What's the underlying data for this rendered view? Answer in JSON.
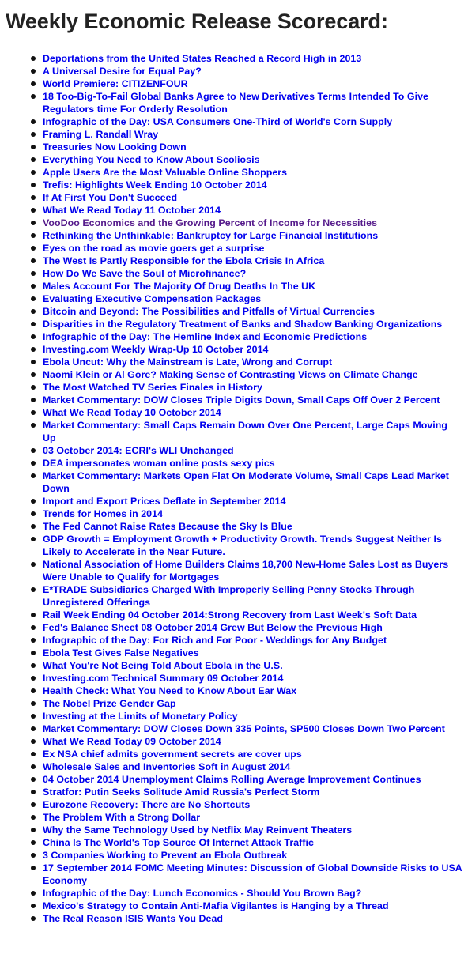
{
  "title": "Weekly Economic Release Scorecard:",
  "colors": {
    "title": "#222222",
    "link": "#0000ee",
    "visited_link": "#551a8b"
  },
  "items": [
    {
      "label": "Deportations from the United States Reached a Record High in 2013",
      "visited": false
    },
    {
      "label": "A Universal Desire for Equal Pay?",
      "visited": false
    },
    {
      "label": "World Premiere: CITIZENFOUR",
      "visited": false
    },
    {
      "label": "18 Too-Big-To-Fail Global Banks Agree to New Derivatives Terms Intended To Give Regulators time For Orderly Resolution",
      "visited": false
    },
    {
      "label": "Infographic of the Day: USA Consumers One-Third of World's Corn Supply",
      "visited": false
    },
    {
      "label": "Framing L. Randall Wray",
      "visited": false
    },
    {
      "label": "Treasuries Now Looking Down",
      "visited": false
    },
    {
      "label": "Everything You Need to Know About Scoliosis",
      "visited": false
    },
    {
      "label": "Apple Users Are the Most Valuable Online Shoppers",
      "visited": false
    },
    {
      "label": "Trefis: Highlights Week Ending 10 October 2014",
      "visited": false
    },
    {
      "label": "If At First You Don't Succeed",
      "visited": false
    },
    {
      "label": "What We Read Today 11 October 2014",
      "visited": false
    },
    {
      "label": "VooDoo Economics and the Growing Percent of Income for Necessities",
      "visited": true
    },
    {
      "label": "Rethinking the Unthinkable: Bankruptcy for Large Financial Institutions",
      "visited": false
    },
    {
      "label": "Eyes on the road as movie goers get a surprise",
      "visited": false
    },
    {
      "label": "The West Is Partly Responsible for the Ebola Crisis In Africa",
      "visited": false
    },
    {
      "label": "How Do We Save the Soul of Microfinance?",
      "visited": false
    },
    {
      "label": "Males Account For The Majority Of Drug Deaths In The UK",
      "visited": false
    },
    {
      "label": "Evaluating Executive Compensation Packages",
      "visited": false
    },
    {
      "label": "Bitcoin and Beyond: The Possibilities and Pitfalls of Virtual Currencies",
      "visited": false
    },
    {
      "label": "Disparities in the Regulatory Treatment of Banks and Shadow Banking Organizations",
      "visited": false
    },
    {
      "label": "Infographic of the Day: The Hemline Index and Economic Predictions",
      "visited": false
    },
    {
      "label": "Investing.com Weekly Wrap-Up 10 October 2014",
      "visited": false
    },
    {
      "label": "Ebola Uncut: Why the Mainstream is Late, Wrong and Corrupt",
      "visited": false
    },
    {
      "label": "Naomi Klein or Al Gore? Making Sense of Contrasting Views on Climate Change",
      "visited": false
    },
    {
      "label": "The Most Watched TV Series Finales in History",
      "visited": false
    },
    {
      "label": "Market Commentary: DOW Closes Triple Digits Down, Small Caps Off Over 2 Percent",
      "visited": false
    },
    {
      "label": "What We Read Today 10 October 2014",
      "visited": false
    },
    {
      "label": "Market Commentary: Small Caps Remain Down Over One Percent, Large Caps Moving Up",
      "visited": false
    },
    {
      "label": "03 October 2014: ECRI's WLI Unchanged",
      "visited": false
    },
    {
      "label": "DEA impersonates woman online posts sexy pics",
      "visited": false
    },
    {
      "label": "Market Commentary: Markets Open Flat On Moderate Volume, Small Caps Lead Market Down",
      "visited": false
    },
    {
      "label": "Import and Export Prices Deflate in September 2014",
      "visited": false
    },
    {
      "label": "Trends for Homes in 2014",
      "visited": false
    },
    {
      "label": "The Fed Cannot Raise Rates Because the Sky Is Blue",
      "visited": false
    },
    {
      "label": "GDP Growth = Employment Growth + Productivity Growth. Trends Suggest Neither Is Likely to Accelerate in the Near Future.",
      "visited": false
    },
    {
      "label": "National Association of Home Builders Claims 18,700 New-Home Sales Lost as Buyers Were Unable to Qualify for Mortgages",
      "visited": false
    },
    {
      "label": "E*TRADE Subsidiaries Charged With Improperly Selling Penny Stocks Through Unregistered Offerings",
      "visited": false
    },
    {
      "label": "Rail Week Ending 04 October 2014:Strong Recovery from Last Week's Soft Data",
      "visited": false
    },
    {
      "label": "Fed's Balance Sheet 08 October 2014 Grew But Below the Previous High",
      "visited": false
    },
    {
      "label": "Infographic of the Day: For Rich and For Poor - Weddings for Any Budget",
      "visited": false
    },
    {
      "label": "Ebola Test Gives False Negatives",
      "visited": false
    },
    {
      "label": "What You're Not Being Told About Ebola in the U.S.",
      "visited": false
    },
    {
      "label": "Investing.com Technical Summary 09 October 2014",
      "visited": false
    },
    {
      "label": "Health Check: What You Need to Know About Ear Wax",
      "visited": false
    },
    {
      "label": "The Nobel Prize Gender Gap",
      "visited": false
    },
    {
      "label": "Investing at the Limits of Monetary Policy",
      "visited": false
    },
    {
      "label": "Market Commentary: DOW Closes Down 335 Points, SP500 Closes Down Two Percent",
      "visited": false
    },
    {
      "label": "What We Read Today 09 October 2014",
      "visited": false
    },
    {
      "label": "Ex NSA chief admits government secrets are cover ups",
      "visited": false
    },
    {
      "label": "Wholesale Sales and Inventories Soft in August 2014",
      "visited": false
    },
    {
      "label": "04 October 2014 Unemployment Claims Rolling Average Improvement Continues",
      "visited": false
    },
    {
      "label": "Stratfor: Putin Seeks Solitude Amid Russia's Perfect Storm",
      "visited": false
    },
    {
      "label": "Eurozone Recovery: There are No Shortcuts",
      "visited": false
    },
    {
      "label": "The Problem With a Strong Dollar",
      "visited": false
    },
    {
      "label": "Why the Same Technology Used by Netflix May Reinvent Theaters",
      "visited": false
    },
    {
      "label": "China Is The World's Top Source Of Internet Attack Traffic",
      "visited": false
    },
    {
      "label": "3 Companies Working to Prevent an Ebola Outbreak",
      "visited": false
    },
    {
      "label": "17 September 2014 FOMC Meeting Minutes: Discussion of Global Downside Risks to USA Economy",
      "visited": false
    },
    {
      "label": "Infographic of the Day: Lunch Economics - Should You Brown Bag?",
      "visited": false
    },
    {
      "label": "Mexico's Strategy to Contain Anti-Mafia Vigilantes is Hanging by a Thread",
      "visited": false
    },
    {
      "label": "The Real Reason ISIS Wants You Dead",
      "visited": false
    }
  ]
}
